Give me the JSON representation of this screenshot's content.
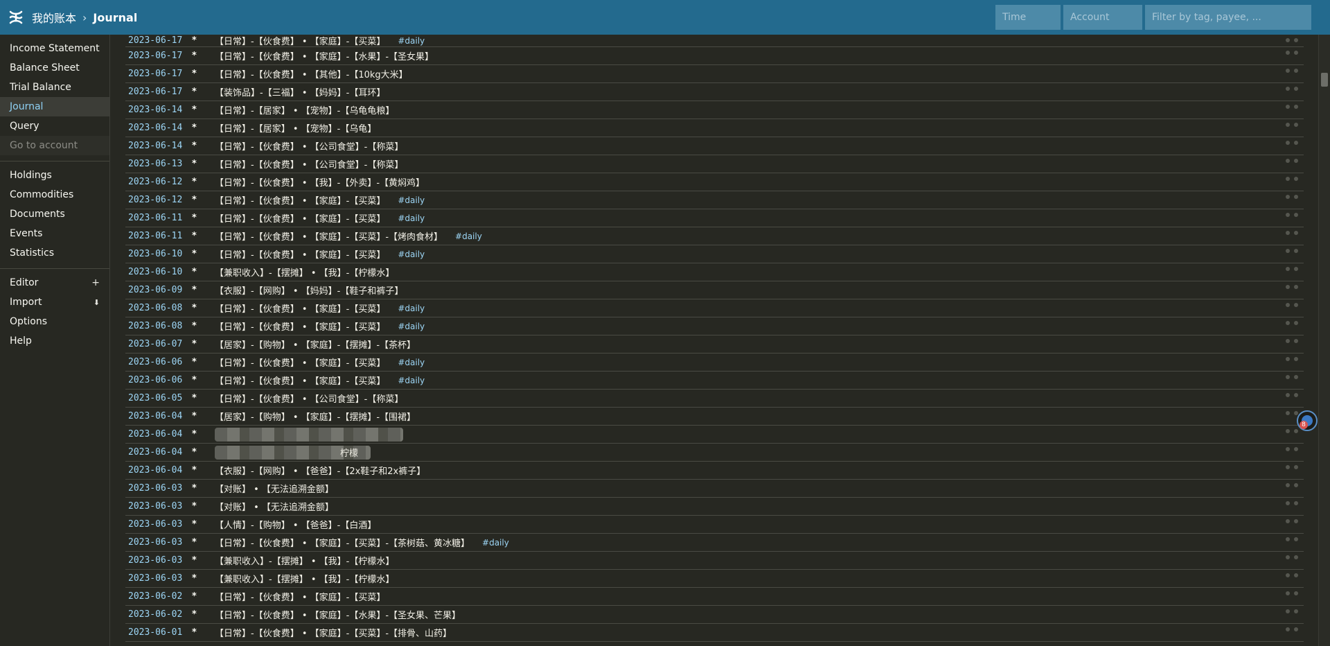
{
  "header": {
    "breadcrumb_root": "我的账本",
    "breadcrumb_sep": "›",
    "breadcrumb_current": "Journal",
    "time_placeholder": "Time",
    "account_placeholder": "Account",
    "filter_placeholder": "Filter by tag, payee, ..."
  },
  "sidebar": {
    "group1": [
      "Income Statement",
      "Balance Sheet",
      "Trial Balance",
      "Journal",
      "Query"
    ],
    "go_to_account": "Go to account",
    "group2": [
      "Holdings",
      "Commodities",
      "Documents",
      "Events",
      "Statistics"
    ],
    "editor": "Editor",
    "editor_suffix": "+",
    "import": "Import",
    "import_suffix": "⬇",
    "options": "Options",
    "help": "Help"
  },
  "floating_badge": {
    "count": "8"
  },
  "colors": {
    "header_bg": "#236a8e",
    "sidebar_active_text": "#8fd1f5",
    "date_text": "#9dd6f6",
    "background": "#272822"
  },
  "journal": {
    "entries": [
      {
        "date": "2023-06-17",
        "flag": "*",
        "narration": "【日常】-【伙食费】 • 【家庭】-【买菜】",
        "tag": "#daily"
      },
      {
        "date": "2023-06-17",
        "flag": "*",
        "narration": "【日常】-【伙食费】 • 【家庭】-【水果】-【圣女果】",
        "tag": ""
      },
      {
        "date": "2023-06-17",
        "flag": "*",
        "narration": "【日常】-【伙食费】 • 【其他】-【10kg大米】",
        "tag": ""
      },
      {
        "date": "2023-06-17",
        "flag": "*",
        "narration": "【装饰品】-【三福】 • 【妈妈】-【耳环】",
        "tag": ""
      },
      {
        "date": "2023-06-14",
        "flag": "*",
        "narration": "【日常】-【居家】 • 【宠物】-【乌龟龟粮】",
        "tag": ""
      },
      {
        "date": "2023-06-14",
        "flag": "*",
        "narration": "【日常】-【居家】 • 【宠物】-【乌龟】",
        "tag": ""
      },
      {
        "date": "2023-06-14",
        "flag": "*",
        "narration": "【日常】-【伙食费】 • 【公司食堂】-【称菜】",
        "tag": ""
      },
      {
        "date": "2023-06-13",
        "flag": "*",
        "narration": "【日常】-【伙食费】 • 【公司食堂】-【称菜】",
        "tag": ""
      },
      {
        "date": "2023-06-12",
        "flag": "*",
        "narration": "【日常】-【伙食费】 • 【我】-【外卖】-【黄焖鸡】",
        "tag": ""
      },
      {
        "date": "2023-06-12",
        "flag": "*",
        "narration": "【日常】-【伙食费】 • 【家庭】-【买菜】",
        "tag": "#daily"
      },
      {
        "date": "2023-06-11",
        "flag": "*",
        "narration": "【日常】-【伙食费】 • 【家庭】-【买菜】",
        "tag": "#daily"
      },
      {
        "date": "2023-06-11",
        "flag": "*",
        "narration": "【日常】-【伙食费】 • 【家庭】-【买菜】-【烤肉食材】",
        "tag": "#daily"
      },
      {
        "date": "2023-06-10",
        "flag": "*",
        "narration": "【日常】-【伙食费】 • 【家庭】-【买菜】",
        "tag": "#daily"
      },
      {
        "date": "2023-06-10",
        "flag": "*",
        "narration": "【兼职收入】-【摆摊】 • 【我】-【柠檬水】",
        "tag": ""
      },
      {
        "date": "2023-06-09",
        "flag": "*",
        "narration": "【衣服】-【网购】 • 【妈妈】-【鞋子和裤子】",
        "tag": ""
      },
      {
        "date": "2023-06-08",
        "flag": "*",
        "narration": "【日常】-【伙食费】 • 【家庭】-【买菜】",
        "tag": "#daily"
      },
      {
        "date": "2023-06-08",
        "flag": "*",
        "narration": "【日常】-【伙食费】 • 【家庭】-【买菜】",
        "tag": "#daily"
      },
      {
        "date": "2023-06-07",
        "flag": "*",
        "narration": "【居家】-【购物】 • 【家庭】-【摆摊】-【茶杯】",
        "tag": ""
      },
      {
        "date": "2023-06-06",
        "flag": "*",
        "narration": "【日常】-【伙食费】 • 【家庭】-【买菜】",
        "tag": "#daily"
      },
      {
        "date": "2023-06-06",
        "flag": "*",
        "narration": "【日常】-【伙食费】 • 【家庭】-【买菜】",
        "tag": "#daily"
      },
      {
        "date": "2023-06-05",
        "flag": "*",
        "narration": "【日常】-【伙食费】 • 【公司食堂】-【称菜】",
        "tag": ""
      },
      {
        "date": "2023-06-04",
        "flag": "*",
        "narration": "【居家】-【购物】 • 【家庭】-【摆摊】-【围裙】",
        "tag": ""
      },
      {
        "date": "2023-06-04",
        "flag": "*",
        "narration": "",
        "tag": ""
      },
      {
        "date": "2023-06-04",
        "flag": "*",
        "narration": "柠檬",
        "tag": ""
      },
      {
        "date": "2023-06-04",
        "flag": "*",
        "narration": "【衣服】-【网购】 • 【爸爸】-【2x鞋子和2x裤子】",
        "tag": ""
      },
      {
        "date": "2023-06-03",
        "flag": "*",
        "narration": "【对账】 • 【无法追溯金额】",
        "tag": ""
      },
      {
        "date": "2023-06-03",
        "flag": "*",
        "narration": "【对账】 • 【无法追溯金额】",
        "tag": ""
      },
      {
        "date": "2023-06-03",
        "flag": "*",
        "narration": "【人情】-【购物】 • 【爸爸】-【白酒】",
        "tag": ""
      },
      {
        "date": "2023-06-03",
        "flag": "*",
        "narration": "【日常】-【伙食费】 • 【家庭】-【买菜】-【茶树菇、黄冰糖】",
        "tag": "#daily"
      },
      {
        "date": "2023-06-03",
        "flag": "*",
        "narration": "【兼职收入】-【摆摊】 • 【我】-【柠檬水】",
        "tag": ""
      },
      {
        "date": "2023-06-03",
        "flag": "*",
        "narration": "【兼职收入】-【摆摊】 • 【我】-【柠檬水】",
        "tag": ""
      },
      {
        "date": "2023-06-02",
        "flag": "*",
        "narration": "【日常】-【伙食费】 • 【家庭】-【买菜】",
        "tag": ""
      },
      {
        "date": "2023-06-02",
        "flag": "*",
        "narration": "【日常】-【伙食费】 • 【家庭】-【水果】-【圣女果、芒果】",
        "tag": ""
      },
      {
        "date": "2023-06-01",
        "flag": "*",
        "narration": "【日常】-【伙食费】 • 【家庭】-【买菜】-【排骨、山药】",
        "tag": ""
      }
    ]
  }
}
